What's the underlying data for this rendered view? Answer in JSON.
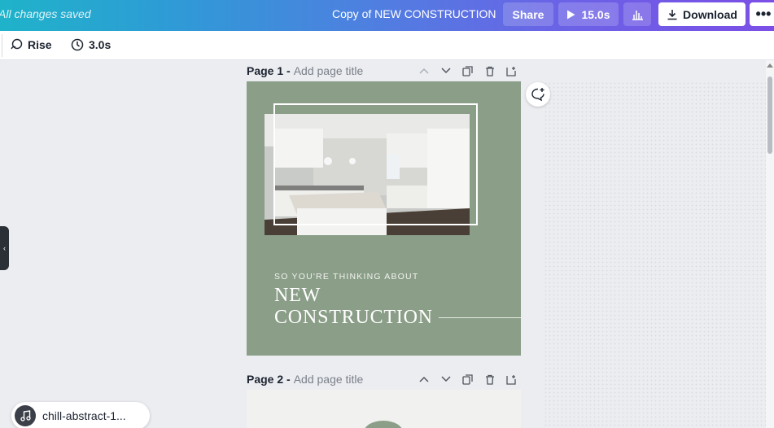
{
  "topbar": {
    "saved_status": "All changes saved",
    "document_title": "Copy of NEW CONSTRUCTION",
    "share_label": "Share",
    "play_duration": "15.0s",
    "download_label": "Download",
    "more_label": "•••"
  },
  "toolbar": {
    "animation_label": "Rise",
    "duration_label": "3.0s"
  },
  "pages": [
    {
      "number_label": "Page 1 -",
      "title_placeholder": "Add page title"
    },
    {
      "number_label": "Page 2 -",
      "title_placeholder": "Add page title"
    }
  ],
  "design": {
    "subtitle": "SO YOU'RE THINKING ABOUT",
    "title_line1": "NEW",
    "title_line2": "CONSTRUCTION",
    "background_color": "#8a9e88"
  },
  "audio": {
    "track_name": "chill-abstract-1..."
  },
  "icons": {
    "play": "play-icon",
    "stats": "bar-chart-icon",
    "download": "download-icon",
    "animation": "rise-animation-icon",
    "timer": "clock-icon",
    "comment": "add-comment-icon",
    "music": "music-note-icon"
  },
  "colors": {
    "accent_gradient_start": "#1fb3c9",
    "accent_gradient_end": "#7b4fe6"
  }
}
